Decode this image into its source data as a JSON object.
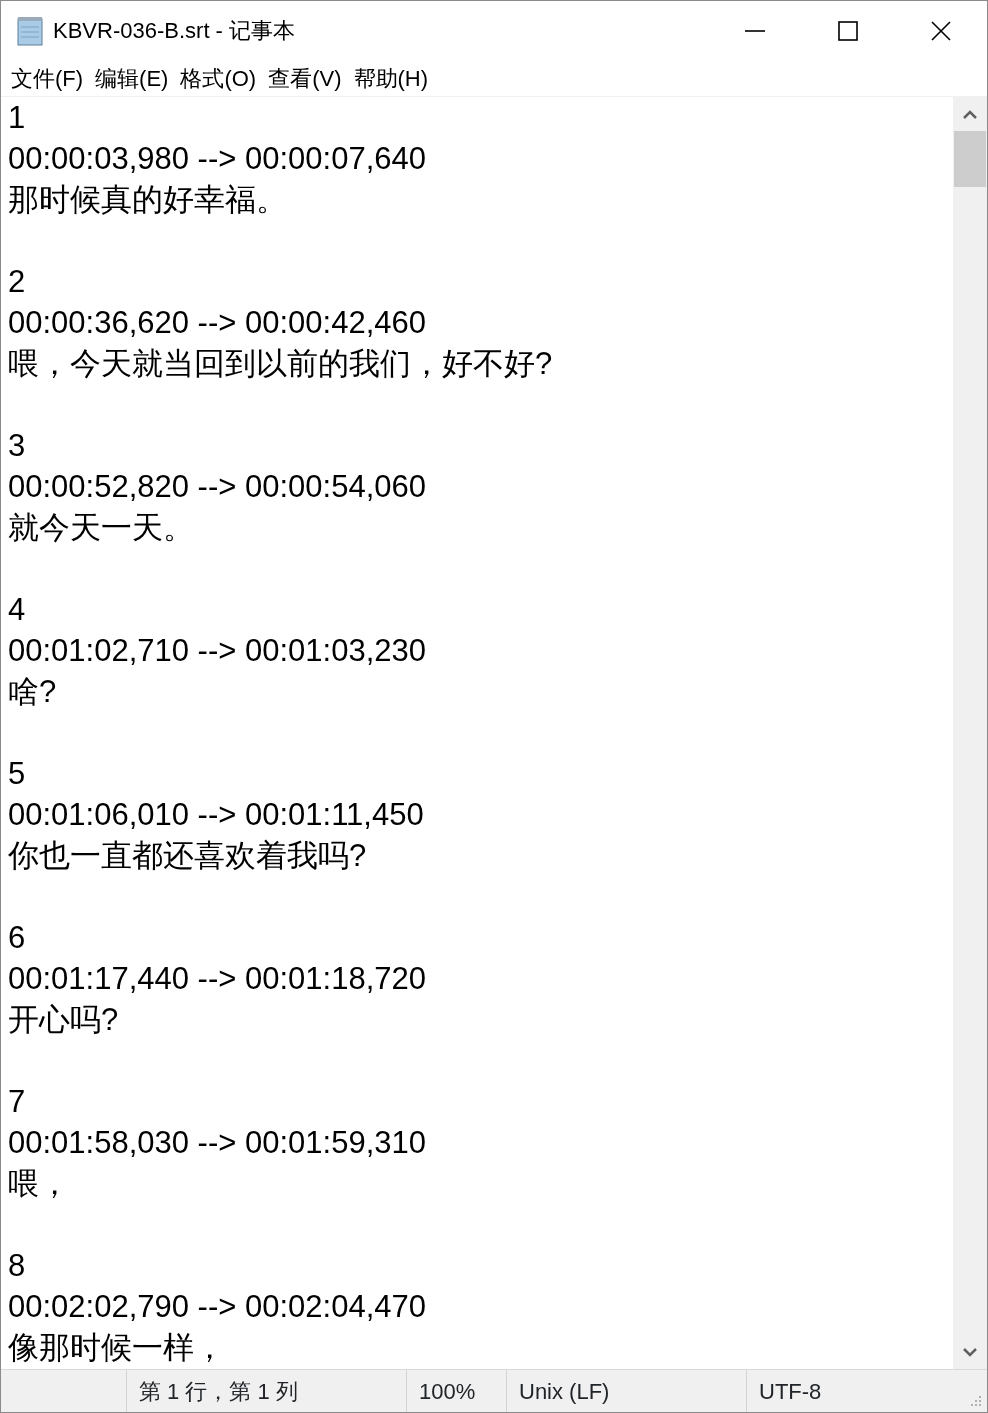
{
  "window": {
    "title": "KBVR-036-B.srt - 记事本"
  },
  "menu": [
    "文件(F)",
    "编辑(E)",
    "格式(O)",
    "查看(V)",
    "帮助(H)"
  ],
  "entries": [
    {
      "index": "1",
      "timing": "00:00:03,980 --> 00:00:07,640",
      "text": "那时候真的好幸福。"
    },
    {
      "index": "2",
      "timing": "00:00:36,620 --> 00:00:42,460",
      "text": "喂，今天就当回到以前的我们，好不好?"
    },
    {
      "index": "3",
      "timing": "00:00:52,820 --> 00:00:54,060",
      "text": "就今天一天。"
    },
    {
      "index": "4",
      "timing": "00:01:02,710 --> 00:01:03,230",
      "text": "啥?"
    },
    {
      "index": "5",
      "timing": "00:01:06,010 --> 00:01:11,450",
      "text": "你也一直都还喜欢着我吗?"
    },
    {
      "index": "6",
      "timing": "00:01:17,440 --> 00:01:18,720",
      "text": "开心吗?"
    },
    {
      "index": "7",
      "timing": "00:01:58,030 --> 00:01:59,310",
      "text": "喂，"
    },
    {
      "index": "8",
      "timing": "00:02:02,790 --> 00:02:04,470",
      "text": "像那时候一样，"
    }
  ],
  "status_bar": {
    "position": "第 1 行，第 1 列",
    "zoom": "100%",
    "line_ending": "Unix (LF)",
    "encoding": "UTF-8"
  }
}
